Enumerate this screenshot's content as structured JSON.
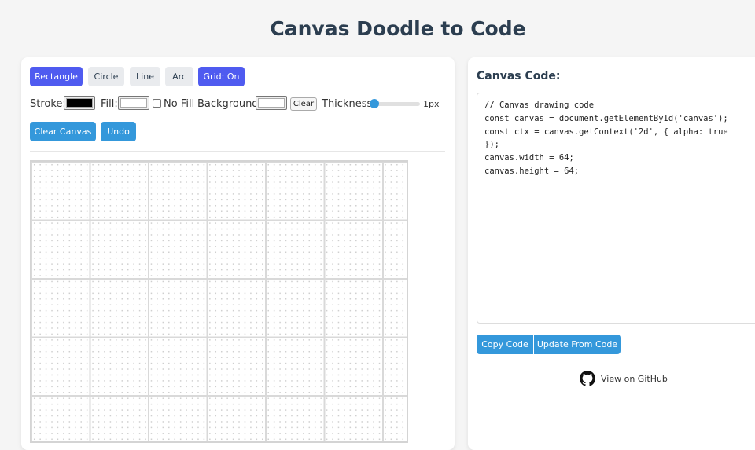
{
  "title": "Canvas Doodle to Code",
  "tools": {
    "rectangle": "Rectangle",
    "circle": "Circle",
    "line": "Line",
    "arc": "Arc",
    "grid": "Grid: On"
  },
  "controls": {
    "stroke_label": "Stroke:",
    "fill_label": "Fill:",
    "no_fill_label": "No Fill",
    "background_label": "Background:",
    "clear_label": "Clear",
    "thickness_label": "Thickness:",
    "thickness_value": "1px",
    "stroke_color": "#000000",
    "fill_color": "#ffffff",
    "background_color": "#ffffff"
  },
  "actions": {
    "clear_canvas": "Clear Canvas",
    "undo": "Undo"
  },
  "code_panel": {
    "title": "Canvas Code:",
    "code": "// Canvas drawing code\nconst canvas = document.getElementById('canvas');\nconst ctx = canvas.getContext('2d', { alpha: true\n});\ncanvas.width = 64;\ncanvas.height = 64;",
    "copy_button": "Copy Code",
    "update_button": "Update From Code",
    "github_link": "View on GitHub"
  },
  "colors": {
    "accent_purple": "#4f5bf0",
    "accent_blue": "#3498db",
    "title_color": "#2c3e50"
  }
}
